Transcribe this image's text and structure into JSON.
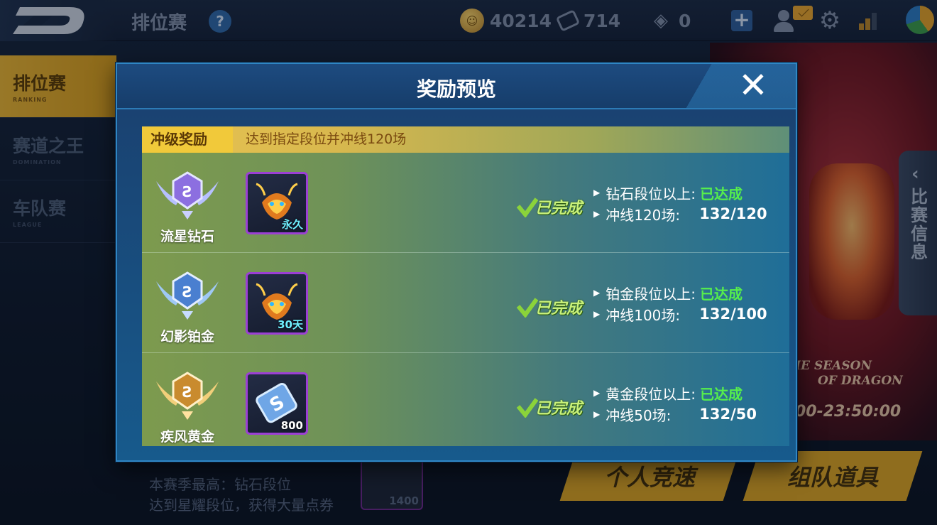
{
  "topbar": {
    "page_title": "排位赛",
    "help_label": "?",
    "coins": "40214",
    "tickets": "714",
    "gems": "0",
    "add_label": "+"
  },
  "sidebar": {
    "items": [
      {
        "zh": "排位赛",
        "en": "RANKING",
        "active": true
      },
      {
        "zh": "赛道之王",
        "en": "DOMINATION",
        "active": false
      },
      {
        "zh": "车队赛",
        "en": "LEAGUE",
        "active": false
      }
    ]
  },
  "side_tab": {
    "label": "比赛信息"
  },
  "background": {
    "season_line1": "HE SEASON",
    "season_line2": "OF DRAGON",
    "time": "00-23:50:00",
    "season_best": "本赛季最高：钻石段位",
    "hint": "达到星耀段位，获得大量点券",
    "card_qty": "1400",
    "btn_solo": "个人竞速",
    "btn_team": "组队道具"
  },
  "modal": {
    "title": "奖励预览",
    "close_icon": "close-icon",
    "section_tag": "冲级奖励",
    "section_desc": "达到指定段位并冲线120场",
    "rows": [
      {
        "rank": "流星钻石",
        "item_qty": "永久",
        "status": "已完成",
        "req1_label": "钻石段位以上:",
        "req1_status": "已达成",
        "req2_label": "冲线120场:",
        "req2_progress": "132/120"
      },
      {
        "rank": "幻影铂金",
        "item_qty": "30天",
        "status": "已完成",
        "req1_label": "铂金段位以上:",
        "req1_status": "已达成",
        "req2_label": "冲线100场:",
        "req2_progress": "132/100"
      },
      {
        "rank": "疾风黄金",
        "item_qty": "800",
        "status": "已完成",
        "req1_label": "黄金段位以上:",
        "req1_status": "已达成",
        "req2_label": "冲线50场:",
        "req2_progress": "132/50"
      }
    ]
  },
  "colors": {
    "accent_gold": "#f1c93a",
    "done_green": "#56ef4c",
    "modal_blue": "#175a8c",
    "item_border": "#9b3fd4"
  }
}
